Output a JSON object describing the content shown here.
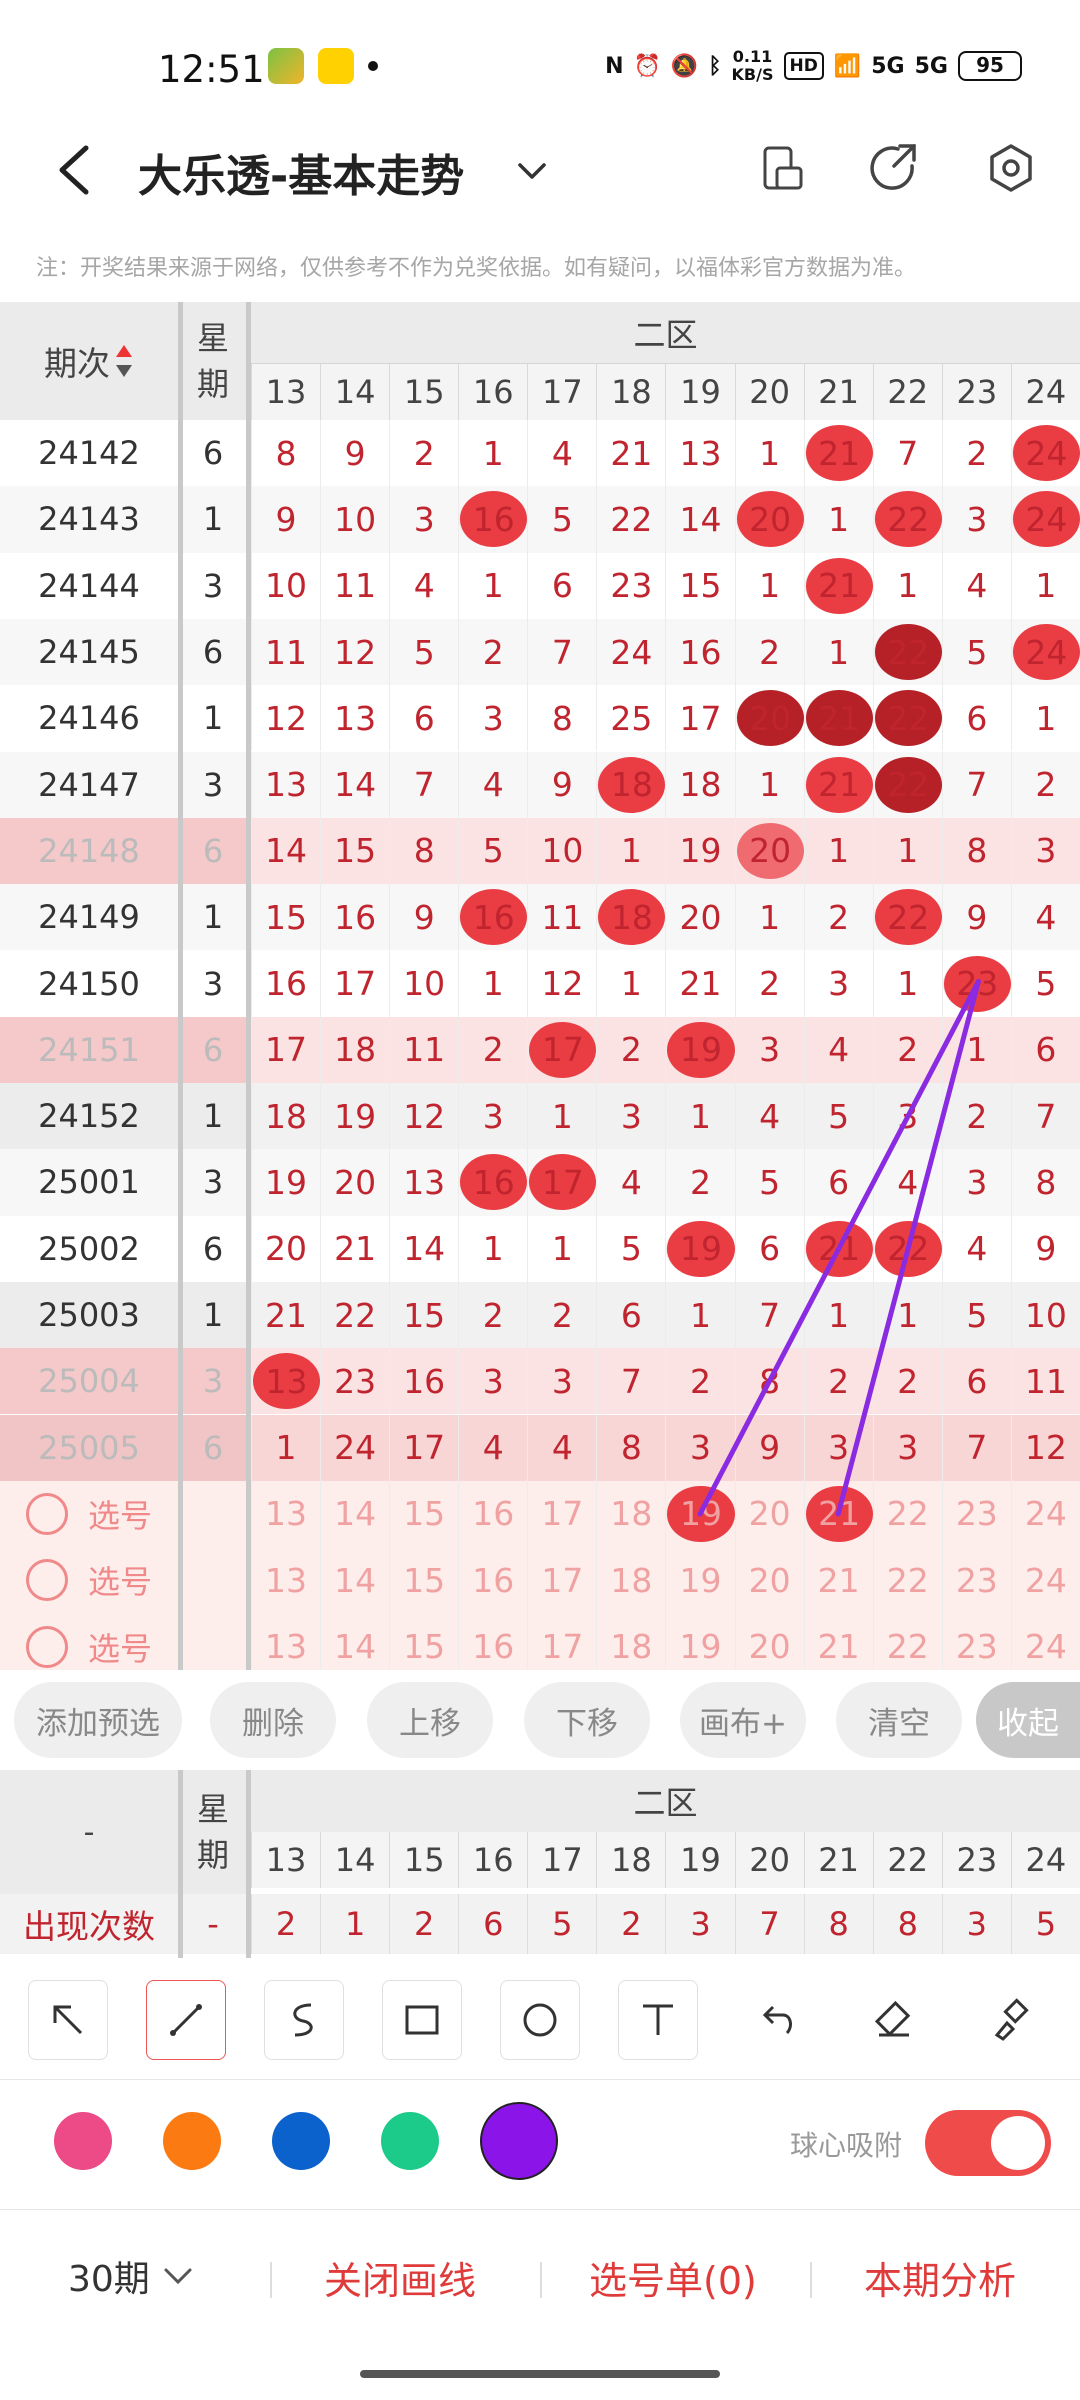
{
  "status": {
    "time": "12:51",
    "speed_top": "0.11",
    "speed_unit": "KB/S",
    "hd": "HD",
    "net1": "5G",
    "net2": "5G",
    "battery": "95"
  },
  "header": {
    "title": "大乐透-基本走势"
  },
  "notice": "注：开奖结果来源于网络，仅供参考不作为兑奖依据。如有疑问，以福体彩官方数据为准。",
  "table": {
    "issue_header": "期次",
    "week_header": "星期",
    "zone": "二区",
    "columns": [
      "13",
      "14",
      "15",
      "16",
      "17",
      "18",
      "19",
      "20",
      "21",
      "22",
      "23",
      "24"
    ],
    "rows": [
      {
        "issue": "24142",
        "week": "6",
        "cells": [
          "8",
          "9",
          "2",
          "1",
          "4",
          "21",
          "13",
          "1",
          "21",
          "7",
          "2",
          "24"
        ],
        "balls": {
          "8": "b1",
          "11": "b1"
        }
      },
      {
        "issue": "24143",
        "week": "1",
        "cells": [
          "9",
          "10",
          "3",
          "16",
          "5",
          "22",
          "14",
          "20",
          "1",
          "22",
          "3",
          "24"
        ],
        "balls": {
          "3": "b1",
          "7": "b1",
          "9": "b1",
          "11": "b1"
        }
      },
      {
        "issue": "24144",
        "week": "3",
        "cells": [
          "10",
          "11",
          "4",
          "1",
          "6",
          "23",
          "15",
          "1",
          "21",
          "1",
          "4",
          "1"
        ],
        "balls": {
          "8": "b1"
        }
      },
      {
        "issue": "24145",
        "week": "6",
        "cells": [
          "11",
          "12",
          "5",
          "2",
          "7",
          "24",
          "16",
          "2",
          "1",
          "22",
          "5",
          "24"
        ],
        "balls": {
          "9": "b2",
          "11": "b1"
        }
      },
      {
        "issue": "24146",
        "week": "1",
        "cells": [
          "12",
          "13",
          "6",
          "3",
          "8",
          "25",
          "17",
          "20",
          "21",
          "22",
          "6",
          "1"
        ],
        "balls": {
          "7": "b2",
          "8": "b2",
          "9": "b2"
        }
      },
      {
        "issue": "24147",
        "week": "3",
        "cells": [
          "13",
          "14",
          "7",
          "4",
          "9",
          "18",
          "18",
          "1",
          "21",
          "22",
          "7",
          "2"
        ],
        "balls": {
          "5": "b1",
          "8": "b1",
          "9": "b2"
        }
      },
      {
        "issue": "24148",
        "week": "6",
        "cells": [
          "14",
          "15",
          "8",
          "5",
          "10",
          "1",
          "19",
          "20",
          "1",
          "1",
          "8",
          "3"
        ],
        "balls": {
          "7": "b3"
        },
        "hl": "pink"
      },
      {
        "issue": "24149",
        "week": "1",
        "cells": [
          "15",
          "16",
          "9",
          "16",
          "11",
          "18",
          "20",
          "1",
          "2",
          "22",
          "9",
          "4"
        ],
        "balls": {
          "3": "b1",
          "5": "b1",
          "9": "b1"
        }
      },
      {
        "issue": "24150",
        "week": "3",
        "cells": [
          "16",
          "17",
          "10",
          "1",
          "12",
          "1",
          "21",
          "2",
          "3",
          "1",
          "23",
          "5"
        ],
        "balls": {
          "10": "b1"
        }
      },
      {
        "issue": "24151",
        "week": "6",
        "cells": [
          "17",
          "18",
          "11",
          "2",
          "17",
          "2",
          "19",
          "3",
          "4",
          "2",
          "1",
          "6"
        ],
        "balls": {
          "4": "b1",
          "6": "b1"
        },
        "hl": "pink"
      },
      {
        "issue": "24152",
        "week": "1",
        "cells": [
          "18",
          "19",
          "12",
          "3",
          "1",
          "3",
          "1",
          "4",
          "5",
          "3",
          "2",
          "7"
        ],
        "balls": {},
        "hl": "grey"
      },
      {
        "issue": "25001",
        "week": "3",
        "cells": [
          "19",
          "20",
          "13",
          "16",
          "17",
          "4",
          "2",
          "5",
          "6",
          "4",
          "3",
          "8"
        ],
        "balls": {
          "3": "b1",
          "4": "b1"
        }
      },
      {
        "issue": "25002",
        "week": "6",
        "cells": [
          "20",
          "21",
          "14",
          "1",
          "1",
          "5",
          "19",
          "6",
          "21",
          "22",
          "4",
          "9"
        ],
        "balls": {
          "6": "b1",
          "8": "b1",
          "9": "b1"
        }
      },
      {
        "issue": "25003",
        "week": "1",
        "cells": [
          "21",
          "22",
          "15",
          "2",
          "2",
          "6",
          "1",
          "7",
          "1",
          "1",
          "5",
          "10"
        ],
        "balls": {},
        "hl": "grey"
      },
      {
        "issue": "25004",
        "week": "3",
        "cells": [
          "13",
          "23",
          "16",
          "3",
          "3",
          "7",
          "2",
          "8",
          "2",
          "2",
          "6",
          "11"
        ],
        "balls": {
          "0": "b1"
        },
        "hl": "pink"
      },
      {
        "issue": "25005",
        "week": "6",
        "cells": [
          "1",
          "24",
          "17",
          "4",
          "4",
          "8",
          "3",
          "9",
          "3",
          "3",
          "7",
          "12"
        ],
        "balls": {},
        "hl": "pink2"
      }
    ],
    "pick_label": "选号",
    "pick_rows": [
      {
        "balls": {
          "6": "b1",
          "8": "b1"
        }
      },
      {
        "balls": {}
      },
      {
        "balls": {}
      }
    ]
  },
  "actions": [
    "添加预选",
    "删除",
    "上移",
    "下移",
    "画布+",
    "清空",
    "收起"
  ],
  "stats": {
    "left_header": "-",
    "week_header": "星期",
    "zone": "二区",
    "row_label": "出现次数",
    "row_week": "-",
    "counts": [
      "2",
      "1",
      "2",
      "6",
      "5",
      "2",
      "3",
      "7",
      "8",
      "8",
      "3",
      "5"
    ]
  },
  "drawing": {
    "tools": [
      "arrow-icon",
      "line-icon",
      "curve-icon",
      "rectangle-icon",
      "circle-icon",
      "text-icon",
      "undo-icon",
      "eraser-icon",
      "clear-brush-icon"
    ],
    "colors": [
      "#ec4b87",
      "#fb7a12",
      "#0c62cc",
      "#1ccb8a",
      "#8b14e8"
    ],
    "snap_label": "球心吸附"
  },
  "bottom": {
    "period": "30期",
    "close_lines": "关闭画线",
    "pick_list": "选号单(0)",
    "analysis": "本期分析"
  },
  "lines": {
    "color": "#8a2be2"
  }
}
